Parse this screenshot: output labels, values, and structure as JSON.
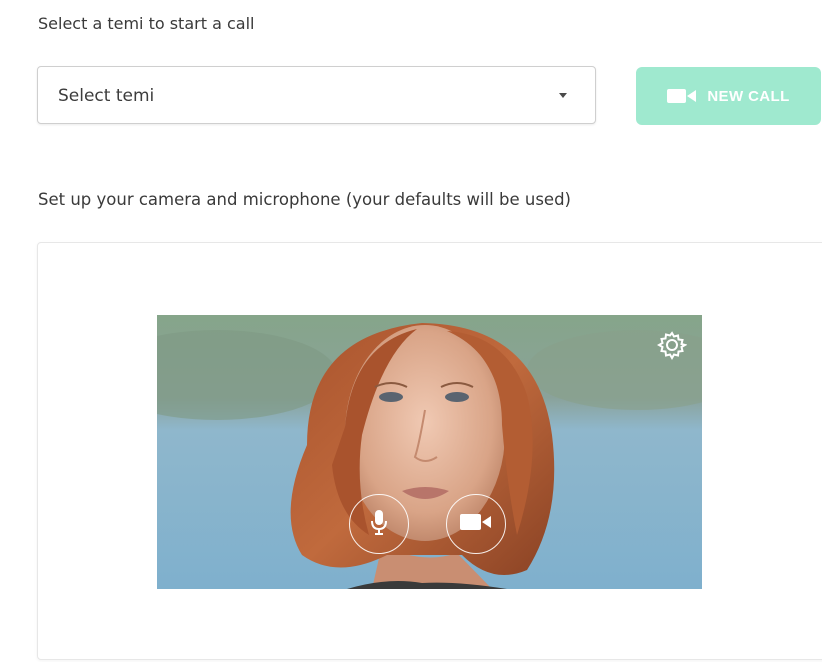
{
  "call": {
    "instruction": "Select a temi to start a call",
    "select": {
      "selected": "Select temi"
    },
    "new_call_label": "NEW CALL"
  },
  "setup": {
    "instruction": "Set up your camera and microphone (your defaults will be used)"
  },
  "icons": {
    "new_call": "video-camera-icon",
    "dropdown": "caret-down-icon",
    "settings": "gear-icon",
    "mic": "microphone-icon",
    "camera": "video-camera-icon"
  },
  "colors": {
    "accent": "#9fe9cf",
    "text": "#3a3a3a"
  }
}
